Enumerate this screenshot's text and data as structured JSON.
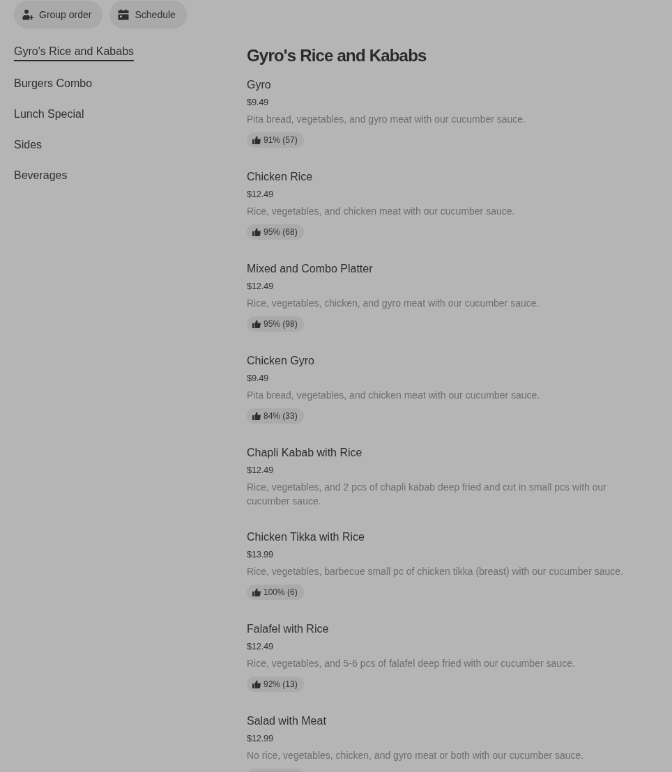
{
  "toolbar": [
    {
      "kind": "group",
      "label": "Group order"
    },
    {
      "kind": "schedule",
      "label": "Schedule"
    }
  ],
  "categories": [
    {
      "label": "Gyro's Rice and Kababs",
      "selected": true
    },
    {
      "label": "Burgers Combo",
      "selected": false
    },
    {
      "label": "Lunch Special",
      "selected": false
    },
    {
      "label": "Sides",
      "selected": false
    },
    {
      "label": "Beverages",
      "selected": false
    }
  ],
  "section": {
    "title": "Gyro's Rice and Kababs",
    "items": [
      {
        "name": "Gyro",
        "price": "$9.49",
        "description": "Pita bread, vegetables, and gyro meat with our cucumber sauce.",
        "rated": true,
        "rating": "91% (57)"
      },
      {
        "name": "Chicken Rice",
        "price": "$12.49",
        "description": "Rice, vegetables, and chicken meat with our cucumber sauce.",
        "rated": true,
        "rating": "95% (68)"
      },
      {
        "name": "Mixed and Combo Platter",
        "price": "$12.49",
        "description": "Rice, vegetables, chicken, and gyro meat with our cucumber sauce.",
        "rated": true,
        "rating": "95% (98)"
      },
      {
        "name": "Chicken Gyro",
        "price": "$9.49",
        "description": "Pita bread, vegetables, and chicken meat with our cucumber sauce.",
        "rated": true,
        "rating": "84% (33)"
      },
      {
        "name": "Chapli Kabab with Rice",
        "price": "$12.49",
        "description": "Rice, vegetables, and 2 pcs of chapli kabab deep fried and cut in small pcs with our cucumber sauce.",
        "rated": false
      },
      {
        "name": "Chicken Tikka with Rice",
        "price": "$13.99",
        "description": "Rice, vegetables, barbecue small pc of chicken tikka (breast) with our cucumber sauce.",
        "rated": true,
        "rating": "100% (6)"
      },
      {
        "name": "Falafel with Rice",
        "price": "$12.49",
        "description": "Rice, vegetables, and 5-6 pcs of falafel deep fried with our cucumber sauce.",
        "rated": true,
        "rating": "92% (13)"
      },
      {
        "name": "Salad with Meat",
        "price": "$12.99",
        "description": "No rice, vegetables, chicken, and gyro meat or both with our cucumber sauce.",
        "rated": true
      }
    ]
  }
}
